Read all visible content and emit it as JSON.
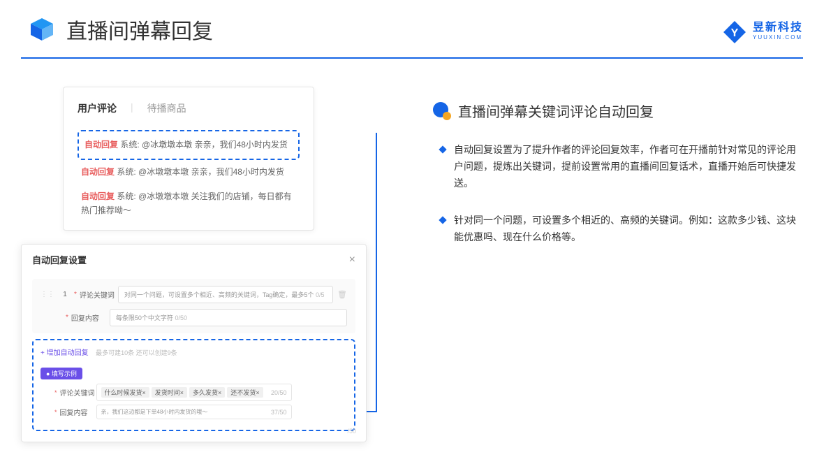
{
  "header": {
    "title": "直播间弹幕回复"
  },
  "brand": {
    "name": "昱新科技",
    "sub": "YUUXIN.COM"
  },
  "left": {
    "tabs": {
      "active": "用户评论",
      "inactive": "待播商品",
      "sep": "|"
    },
    "comments": [
      {
        "tag": "自动回复",
        "sys": "系统:",
        "text": "@冰墩墩本墩 亲亲，我们48小时内发货",
        "highlight": true
      },
      {
        "tag": "自动回复",
        "sys": "系统:",
        "text": "@冰墩墩本墩 亲亲，我们48小时内发货",
        "highlight": false
      },
      {
        "tag": "自动回复",
        "sys": "系统:",
        "text": "@冰墩墩本墩 关注我们的店铺，每日都有热门推荐呦～",
        "highlight": false
      }
    ],
    "settings": {
      "title": "自动回复设置",
      "rownum": "1",
      "kw_label": "评论关键词",
      "kw_placeholder": "对同一个问题，可设置多个相近、高频的关键词，Tag确定，最多5个",
      "kw_counter": "0/5",
      "content_label": "回复内容",
      "content_placeholder": "每条限50个中文字符",
      "content_counter": "0/50",
      "add_link": "+ 增加自动回复",
      "add_hint": "最多可建10条 还可以创建9条",
      "example_badge": "● 填写示例",
      "ex_kw_label": "评论关键词",
      "ex_kw_tags": [
        "什么时候发货×",
        "发货时间×",
        "多久发货×",
        "还不发货×"
      ],
      "ex_kw_counter": "20/50",
      "ex_content_label": "回复内容",
      "ex_content_text": "亲，我们这边都是下单48小时内发货的哦～",
      "ex_content_counter": "37/50",
      "bottom_counter": "/50"
    }
  },
  "right": {
    "section_title": "直播间弹幕关键词评论自动回复",
    "bullets": [
      "自动回复设置为了提升作者的评论回复效率，作者可在开播前针对常见的评论用户问题，提炼出关键词，提前设置常用的直播间回复话术，直播开始后可快捷发送。",
      "针对同一个问题，可设置多个相近的、高频的关键词。例如：这款多少钱、这块能优惠吗、现在什么价格等。"
    ]
  }
}
